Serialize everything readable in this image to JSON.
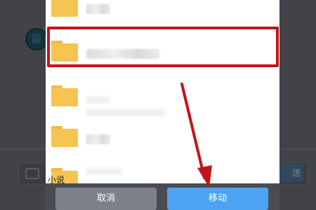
{
  "folders": [
    {
      "name": ""
    },
    {
      "name": ""
    },
    {
      "name": ""
    },
    {
      "name": ""
    },
    {
      "name": "小说"
    }
  ],
  "buttons": {
    "cancel": "取消",
    "move": "移动"
  },
  "background": {
    "send_label": "送"
  },
  "colors": {
    "highlight": "#c3141b",
    "arrow": "#c3141b",
    "move_button": "#4da3f2",
    "cancel_button": "#7d818b",
    "folder": "#f5c452"
  },
  "icons": [
    "folder-icon",
    "down-arrow-annotation",
    "avatar"
  ]
}
